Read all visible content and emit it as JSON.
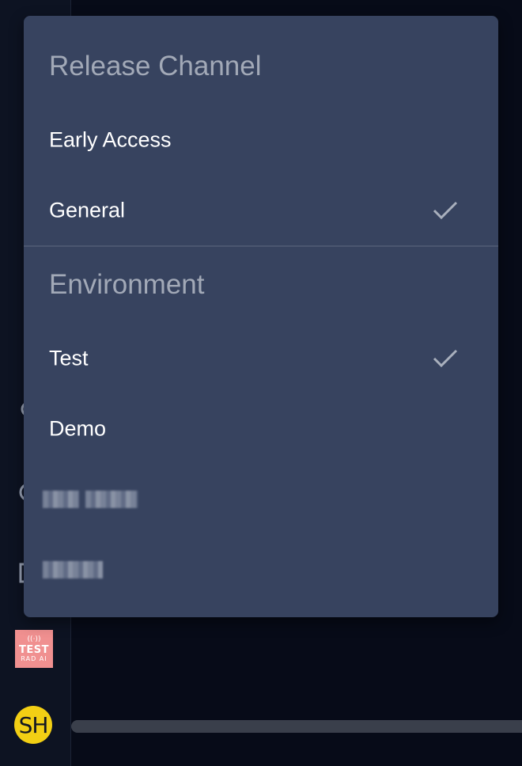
{
  "menu": {
    "release_channel": {
      "title": "Release Channel",
      "items": [
        {
          "label": "Early Access",
          "selected": false
        },
        {
          "label": "General",
          "selected": true
        }
      ]
    },
    "environment": {
      "title": "Environment",
      "items": [
        {
          "label": "Test",
          "selected": true
        },
        {
          "label": "Demo",
          "selected": false
        }
      ]
    }
  },
  "sidebar": {
    "env_badge": {
      "line1": "TEST",
      "line2": "RAD AI",
      "icon": "broadcast-icon"
    },
    "avatar_initials": "SH"
  },
  "colors": {
    "menu_bg": "#37435f",
    "app_bg": "#070b18",
    "sidebar_bg": "#0d1322",
    "badge_bg": "#f09090",
    "avatar_bg": "#f2cf14"
  }
}
